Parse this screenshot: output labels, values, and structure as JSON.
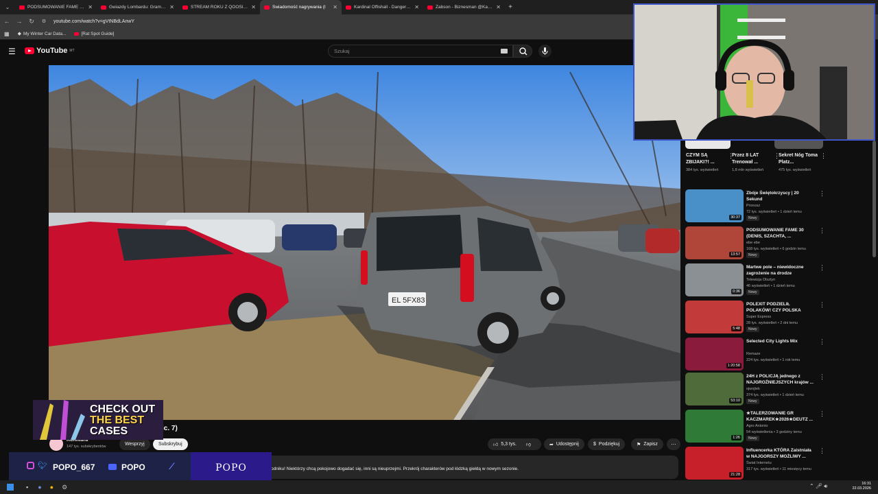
{
  "browser": {
    "tabs": [
      {
        "label": "PODSUMOWANIE FAME 30 (DE",
        "active": false
      },
      {
        "label": "Gwiazdy Lombardu: Gramy w E",
        "active": false
      },
      {
        "label": "STREAM ROKU Z QOOSIK | W5",
        "active": false
      },
      {
        "label": "Świadomość nagrywania (I",
        "active": true
      },
      {
        "label": "Kardinal Offishall - Dangerous",
        "active": false
      },
      {
        "label": "Żabson - Biznesman @Kabi Pr",
        "active": false
      }
    ],
    "url": "youtube.com/watch?v=gVtNBdLAnwY",
    "bookmarks": [
      "My Winter Car Data...",
      "[Rat Spot Guide]"
    ]
  },
  "youtube": {
    "logo_text": "YouTube",
    "logo_country": "MT",
    "search_placeholder": "Szukaj"
  },
  "video": {
    "title_visible": "ic. 7)",
    "channel_name": "Konfitura",
    "channel_subs": "147 tys. subskrybentów",
    "support_label": "Wesprzyj",
    "subscribe_label": "Subskrybuj",
    "likes": "5,3 tys.",
    "share_label": "Udostępnij",
    "thanks_label": "Podziękuj",
    "save_label": "Zapisz",
    "description": "odniku! Niektórzy chcą pokojowo dogadać się, inni są nieuprzejmi. Przekrój charakterów pod łódzką giełdą w nowym sezonie."
  },
  "overlay": {
    "promo_line1": "CHECK OUT",
    "promo_line2": "THE BEST",
    "promo_line3": "CASES",
    "handle": "POPO_667",
    "yt_handle": "POPO",
    "banner": "POPO"
  },
  "shorts": [
    {
      "title": "CZYM SĄ ZBIJAKI?! ...",
      "views": "384 tys. wyświetleń"
    },
    {
      "title": "Przez 8 LAT Trenował ...",
      "views": "1,8 mln wyświetleń"
    },
    {
      "title": "Sekret Nóg Toma Platz...",
      "views": "475 tys. wyświetleń"
    }
  ],
  "recommendations": [
    {
      "title": "Zbóje Świętokrzyscy | 20 Sekund",
      "channel": "Pronosz",
      "meta": "72 tys. wyświetleń • 1 dzień temu",
      "badge": "Nowy",
      "duration": "30:37",
      "color": "#4a90c8"
    },
    {
      "title": "PODSUMOWANIE FAME 30 (DENIS, SZACHTA, ...",
      "channel": "ebe ebe",
      "meta": "168 tys. wyświetleń • 6 godzin temu",
      "badge": "Nowy",
      "duration": "13:57",
      "color": "#b0453a"
    },
    {
      "title": "Martwe pole – niewidoczne zagrożenie na drodze",
      "channel": "Telewizja Olsztyn",
      "meta": "46 wyświetleń • 1 dzień temu",
      "badge": "Nowy",
      "duration": "0:36",
      "color": "#8a9094"
    },
    {
      "title": "POLEXIT PODZIELIŁ POLAKÓW! CZY POLSKA POWINNA WYJŚ...",
      "channel": "Super Express",
      "meta": "28 tys. wyświetleń • 2 dni temu",
      "badge": "Nowy",
      "duration": "5:48",
      "color": "#c23a3a"
    },
    {
      "title": "Selected City Lights Mix",
      "channel": "Remaze",
      "meta": "224 tys. wyświetleń • 1 rok temu",
      "badge": "",
      "duration": "1:20:58",
      "color": "#8a1b3d"
    },
    {
      "title": "24H z POLICJĄ jednego z NAJGROŹNIEJSZYCH krajów ...",
      "channel": "ojwojtek",
      "meta": "374 tys. wyświetleń • 1 dzień temu",
      "badge": "Nowy",
      "duration": "53:10",
      "color": "#4f6b3a"
    },
    {
      "title": "★TALERZOWANIE GR KACZMAREK★2026★DEUTZ ...",
      "channel": "Agro Antonio",
      "meta": "54 wyświetlenia • 3 godziny temu",
      "badge": "Nowy",
      "duration": "1:26",
      "color": "#2f7a36"
    },
    {
      "title": "Influencerka KTÓRA Zaistniała w NAJGORSZY MOŻLIWY ...",
      "channel": "Świat Internetu",
      "meta": "317 tys. wyświetleń • 11 miesięcy temu",
      "badge": "",
      "duration": "21:28",
      "color": "#c7202a"
    }
  ],
  "taskbar": {
    "time": "16:31",
    "date": "22.03.2026"
  }
}
